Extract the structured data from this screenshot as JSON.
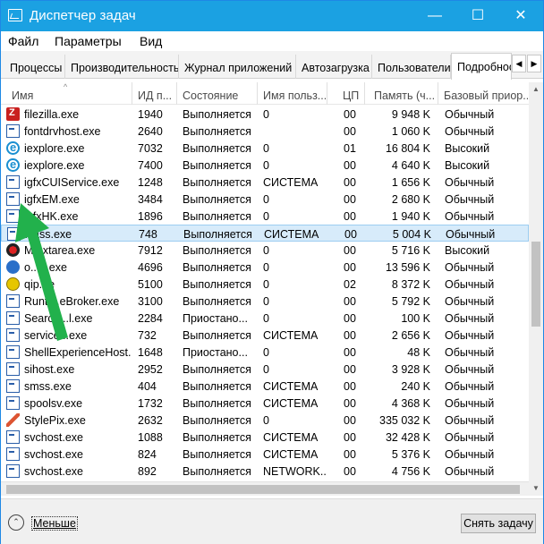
{
  "window": {
    "title": "Диспетчер задач",
    "minimize_glyph": "—",
    "maximize_glyph": "☐",
    "close_glyph": "✕"
  },
  "menu": [
    "Файл",
    "Параметры",
    "Вид"
  ],
  "tabs": [
    "Процессы",
    "Производительность",
    "Журнал приложений",
    "Автозагрузка",
    "Пользователи",
    "Подробност"
  ],
  "tab_scroll": {
    "left": "◀",
    "right": "▶"
  },
  "columns": [
    "Имя",
    "ИД п...",
    "Состояние",
    "Имя польз...",
    "ЦП",
    "Память (ч...",
    "Базовый приор..."
  ],
  "sort_indicator": "^",
  "rows": [
    {
      "icon": "filezilla-icon",
      "name": "filezilla.exe",
      "pid": "1940",
      "state": "Выполняется",
      "user": "0",
      "cpu": "00",
      "mem": "9 948 K",
      "prio": "Обычный"
    },
    {
      "icon": "window-icon",
      "name": "fontdrvhost.exe",
      "pid": "2640",
      "state": "Выполняется",
      "user": "",
      "cpu": "00",
      "mem": "1 060 K",
      "prio": "Обычный"
    },
    {
      "icon": "internet-explorer-icon",
      "name": "iexplore.exe",
      "pid": "7032",
      "state": "Выполняется",
      "user": "0",
      "cpu": "01",
      "mem": "16 804 K",
      "prio": "Высокий"
    },
    {
      "icon": "internet-explorer-icon",
      "name": "iexplore.exe",
      "pid": "7400",
      "state": "Выполняется",
      "user": "0",
      "cpu": "00",
      "mem": "4 640 K",
      "prio": "Высокий"
    },
    {
      "icon": "window-icon",
      "name": "igfxCUIService.exe",
      "pid": "1248",
      "state": "Выполняется",
      "user": "СИСТЕМА",
      "cpu": "00",
      "mem": "1 656 K",
      "prio": "Обычный"
    },
    {
      "icon": "window-icon",
      "name": "igfxEM.exe",
      "pid": "3484",
      "state": "Выполняется",
      "user": "0",
      "cpu": "00",
      "mem": "2 680 K",
      "prio": "Обычный"
    },
    {
      "icon": "window-icon",
      "name": "igfxHK.exe",
      "pid": "1896",
      "state": "Выполняется",
      "user": "0",
      "cpu": "00",
      "mem": "1 940 K",
      "prio": "Обычный"
    },
    {
      "icon": "window-icon",
      "name": "lsass.exe",
      "pid": "748",
      "state": "Выполняется",
      "user": "СИСТЕМА",
      "cpu": "00",
      "mem": "5 004 K",
      "prio": "Обычный",
      "selected": true
    },
    {
      "icon": "red-circle-icon",
      "name": "M...xtarea.exe",
      "pid": "7912",
      "state": "Выполняется",
      "user": "0",
      "cpu": "00",
      "mem": "5 716 K",
      "prio": "Высокий"
    },
    {
      "icon": "blue-globe-icon",
      "name": "o...h.exe",
      "pid": "4696",
      "state": "Выполняется",
      "user": "0",
      "cpu": "00",
      "mem": "13 596 K",
      "prio": "Обычный"
    },
    {
      "icon": "qip-icon",
      "name": "qip...e",
      "pid": "5100",
      "state": "Выполняется",
      "user": "0",
      "cpu": "02",
      "mem": "8 372 K",
      "prio": "Обычный"
    },
    {
      "icon": "window-icon",
      "name": "Runti...eBroker.exe",
      "pid": "3100",
      "state": "Выполняется",
      "user": "0",
      "cpu": "00",
      "mem": "5 792 K",
      "prio": "Обычный"
    },
    {
      "icon": "window-icon",
      "name": "Search...l.exe",
      "pid": "2284",
      "state": "Приостано...",
      "user": "0",
      "cpu": "00",
      "mem": "100 K",
      "prio": "Обычный"
    },
    {
      "icon": "window-icon",
      "name": "service...exe",
      "pid": "732",
      "state": "Выполняется",
      "user": "СИСТЕМА",
      "cpu": "00",
      "mem": "2 656 K",
      "prio": "Обычный"
    },
    {
      "icon": "window-icon",
      "name": "ShellExperienceHost....",
      "pid": "1648",
      "state": "Приостано...",
      "user": "0",
      "cpu": "00",
      "mem": "48 K",
      "prio": "Обычный"
    },
    {
      "icon": "window-icon",
      "name": "sihost.exe",
      "pid": "2952",
      "state": "Выполняется",
      "user": "0",
      "cpu": "00",
      "mem": "3 928 K",
      "prio": "Обычный"
    },
    {
      "icon": "window-icon",
      "name": "smss.exe",
      "pid": "404",
      "state": "Выполняется",
      "user": "СИСТЕМА",
      "cpu": "00",
      "mem": "240 K",
      "prio": "Обычный"
    },
    {
      "icon": "printer-icon",
      "name": "spoolsv.exe",
      "pid": "1732",
      "state": "Выполняется",
      "user": "СИСТЕМА",
      "cpu": "00",
      "mem": "4 368 K",
      "prio": "Обычный"
    },
    {
      "icon": "stylepix-icon",
      "name": "StylePix.exe",
      "pid": "2632",
      "state": "Выполняется",
      "user": "0",
      "cpu": "00",
      "mem": "335 032 K",
      "prio": "Обычный"
    },
    {
      "icon": "window-icon",
      "name": "svchost.exe",
      "pid": "1088",
      "state": "Выполняется",
      "user": "СИСТЕМА",
      "cpu": "00",
      "mem": "32 428 K",
      "prio": "Обычный"
    },
    {
      "icon": "window-icon",
      "name": "svchost.exe",
      "pid": "824",
      "state": "Выполняется",
      "user": "СИСТЕМА",
      "cpu": "00",
      "mem": "5 376 K",
      "prio": "Обычный"
    },
    {
      "icon": "window-icon",
      "name": "svchost.exe",
      "pid": "892",
      "state": "Выполняется",
      "user": "NETWORK...",
      "cpu": "00",
      "mem": "4 756 K",
      "prio": "Обычный"
    }
  ],
  "scroll": {
    "up": "▲",
    "down": "▼"
  },
  "footer": {
    "less_glyph": "⌃",
    "less_label": "Меньше",
    "end_task": "Снять задачу"
  },
  "colors": {
    "titlebar": "#1ba1e2",
    "selection": "#d7ebfa",
    "arrow": "#22b14c"
  }
}
